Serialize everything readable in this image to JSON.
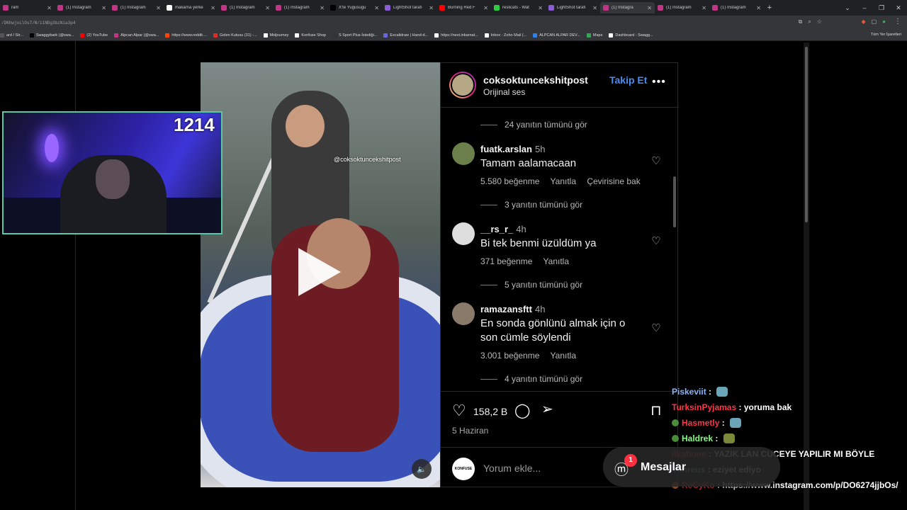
{
  "browser": {
    "tabs": [
      {
        "label": "ram",
        "color": "#c13584"
      },
      {
        "label": "(1) Instagram",
        "color": "#c13584"
      },
      {
        "label": "(1) Instagram",
        "color": "#c13584"
      },
      {
        "label": "makarna yerke",
        "color": "#ffffff"
      },
      {
        "label": "(1) Instagram",
        "color": "#c13584"
      },
      {
        "label": "(1) Instagram",
        "color": "#c13584"
      },
      {
        "label": "X'te Yugusugu",
        "color": "#000000"
      },
      {
        "label": "LightShot tarafı",
        "color": "#8a5cd6"
      },
      {
        "label": "Burning Red F",
        "color": "#ff0000"
      },
      {
        "label": "reslicats - Wat",
        "color": "#2ecc40"
      },
      {
        "label": "LightShot tarafı",
        "color": "#8a5cd6"
      },
      {
        "label": "(1) Instagra",
        "color": "#c13584"
      },
      {
        "label": "(1) Instagram",
        "color": "#c13584"
      },
      {
        "label": "(1) Instagram",
        "color": "#c13584"
      }
    ],
    "url": "/DKhwjoLlOs7/N/i1NDg3bzNia3p4",
    "bookmarks": [
      {
        "label": "ard / Str...",
        "color": "#555555"
      },
      {
        "label": "Swaggybark (@swa...",
        "color": "#000000"
      },
      {
        "label": "(2) YouTube",
        "color": "#ff0000"
      },
      {
        "label": "Alpcan Alpar (@swa...",
        "color": "#c13584"
      },
      {
        "label": "https://www.reddit....",
        "color": "#ff4500"
      },
      {
        "label": "Gelen Kutusu (31) -...",
        "color": "#d93025"
      },
      {
        "label": "Midjourney",
        "color": "#ffffff"
      },
      {
        "label": "Konfuse Shop",
        "color": "#ffffff"
      },
      {
        "label": "S Sport Plus-İstediği...",
        "color": "#333333"
      },
      {
        "label": "Excalidraw | Hand-d...",
        "color": "#6965db"
      },
      {
        "label": "https://next.inkarnat...",
        "color": "#ffffff"
      },
      {
        "label": "Inbox - Zoho Mail (...",
        "color": "#ffffff"
      },
      {
        "label": "ALPCAN ALPAR DEV...",
        "color": "#2f80ed"
      },
      {
        "label": "Maps",
        "color": "#34a853"
      },
      {
        "label": "Dashboard - Swagg...",
        "color": "#ffffff"
      }
    ],
    "all_bookmarks": "Tüm Yer İşaretleri"
  },
  "post": {
    "username": "coksoktuncekshitpost",
    "audio": "Orijinal ses",
    "follow": "Takip Et",
    "watermark": "@coksoktuncekshitpost",
    "likes": "158,2 B",
    "date": "5 Haziran",
    "comment_placeholder": "Yorum ekle...",
    "commenter_avatar": "KONFUSE"
  },
  "comments": [
    {
      "user": "fuatk.arslan",
      "time": "5h",
      "text": "Tamam aalamacaan",
      "likes": "5.580 beğenme",
      "reply": "Yanıtla",
      "translate": "Çevirisine bak",
      "replies": "3 yanıtın tümünü gör",
      "avatar_color": "#6b7f4a"
    },
    {
      "user": "__rs_r_",
      "time": "4h",
      "text": "Bi tek benmi üzüldüm ya",
      "likes": "371 beğenme",
      "reply": "Yanıtla",
      "translate": "",
      "replies": "5 yanıtın tümünü gör",
      "avatar_color": "#dddddd"
    },
    {
      "user": "ramazansftt",
      "time": "4h",
      "text": "En sonda gönlünü almak için o son cümle söylendi",
      "likes": "3.001 beğenme",
      "reply": "Yanıtla",
      "translate": "",
      "replies": "4 yanıtın tümünü gör",
      "avatar_color": "#8a7a6a"
    }
  ],
  "top_replies": "24 yanıtın tümünü gör",
  "stream": {
    "counter": "1214"
  },
  "chat": [
    {
      "user": "Piskeviit",
      "color": "#8ab4f8",
      "msg": "",
      "badge": ""
    },
    {
      "user": "TurksinPyjamas",
      "color": "#ff3344",
      "msg": "yoruma bak",
      "badge": ""
    },
    {
      "user": "Hasmetly",
      "color": "#ff3344",
      "msg": "",
      "badge": "#4a8c3a"
    },
    {
      "user": "Haldrek",
      "color": "#7dff7d",
      "msg": "",
      "badge": "#4a8c3a"
    },
    {
      "user": "ilkabone",
      "color": "#ff3344",
      "msg": "YAZIK LAN CUCEYE YAPILIR MI BÖYLE",
      "badge": ""
    },
    {
      "user": "Ykhreus",
      "color": "#5bc0de",
      "msg": "eziyet ediyo",
      "badge": ""
    },
    {
      "user": "ReCyKo",
      "color": "#ff3344",
      "msg": "https://www.instagram.com/p/DO6274jjbOs/",
      "badge": "#d96a2b"
    }
  ],
  "messages": {
    "label": "Mesajlar",
    "count": "1"
  }
}
